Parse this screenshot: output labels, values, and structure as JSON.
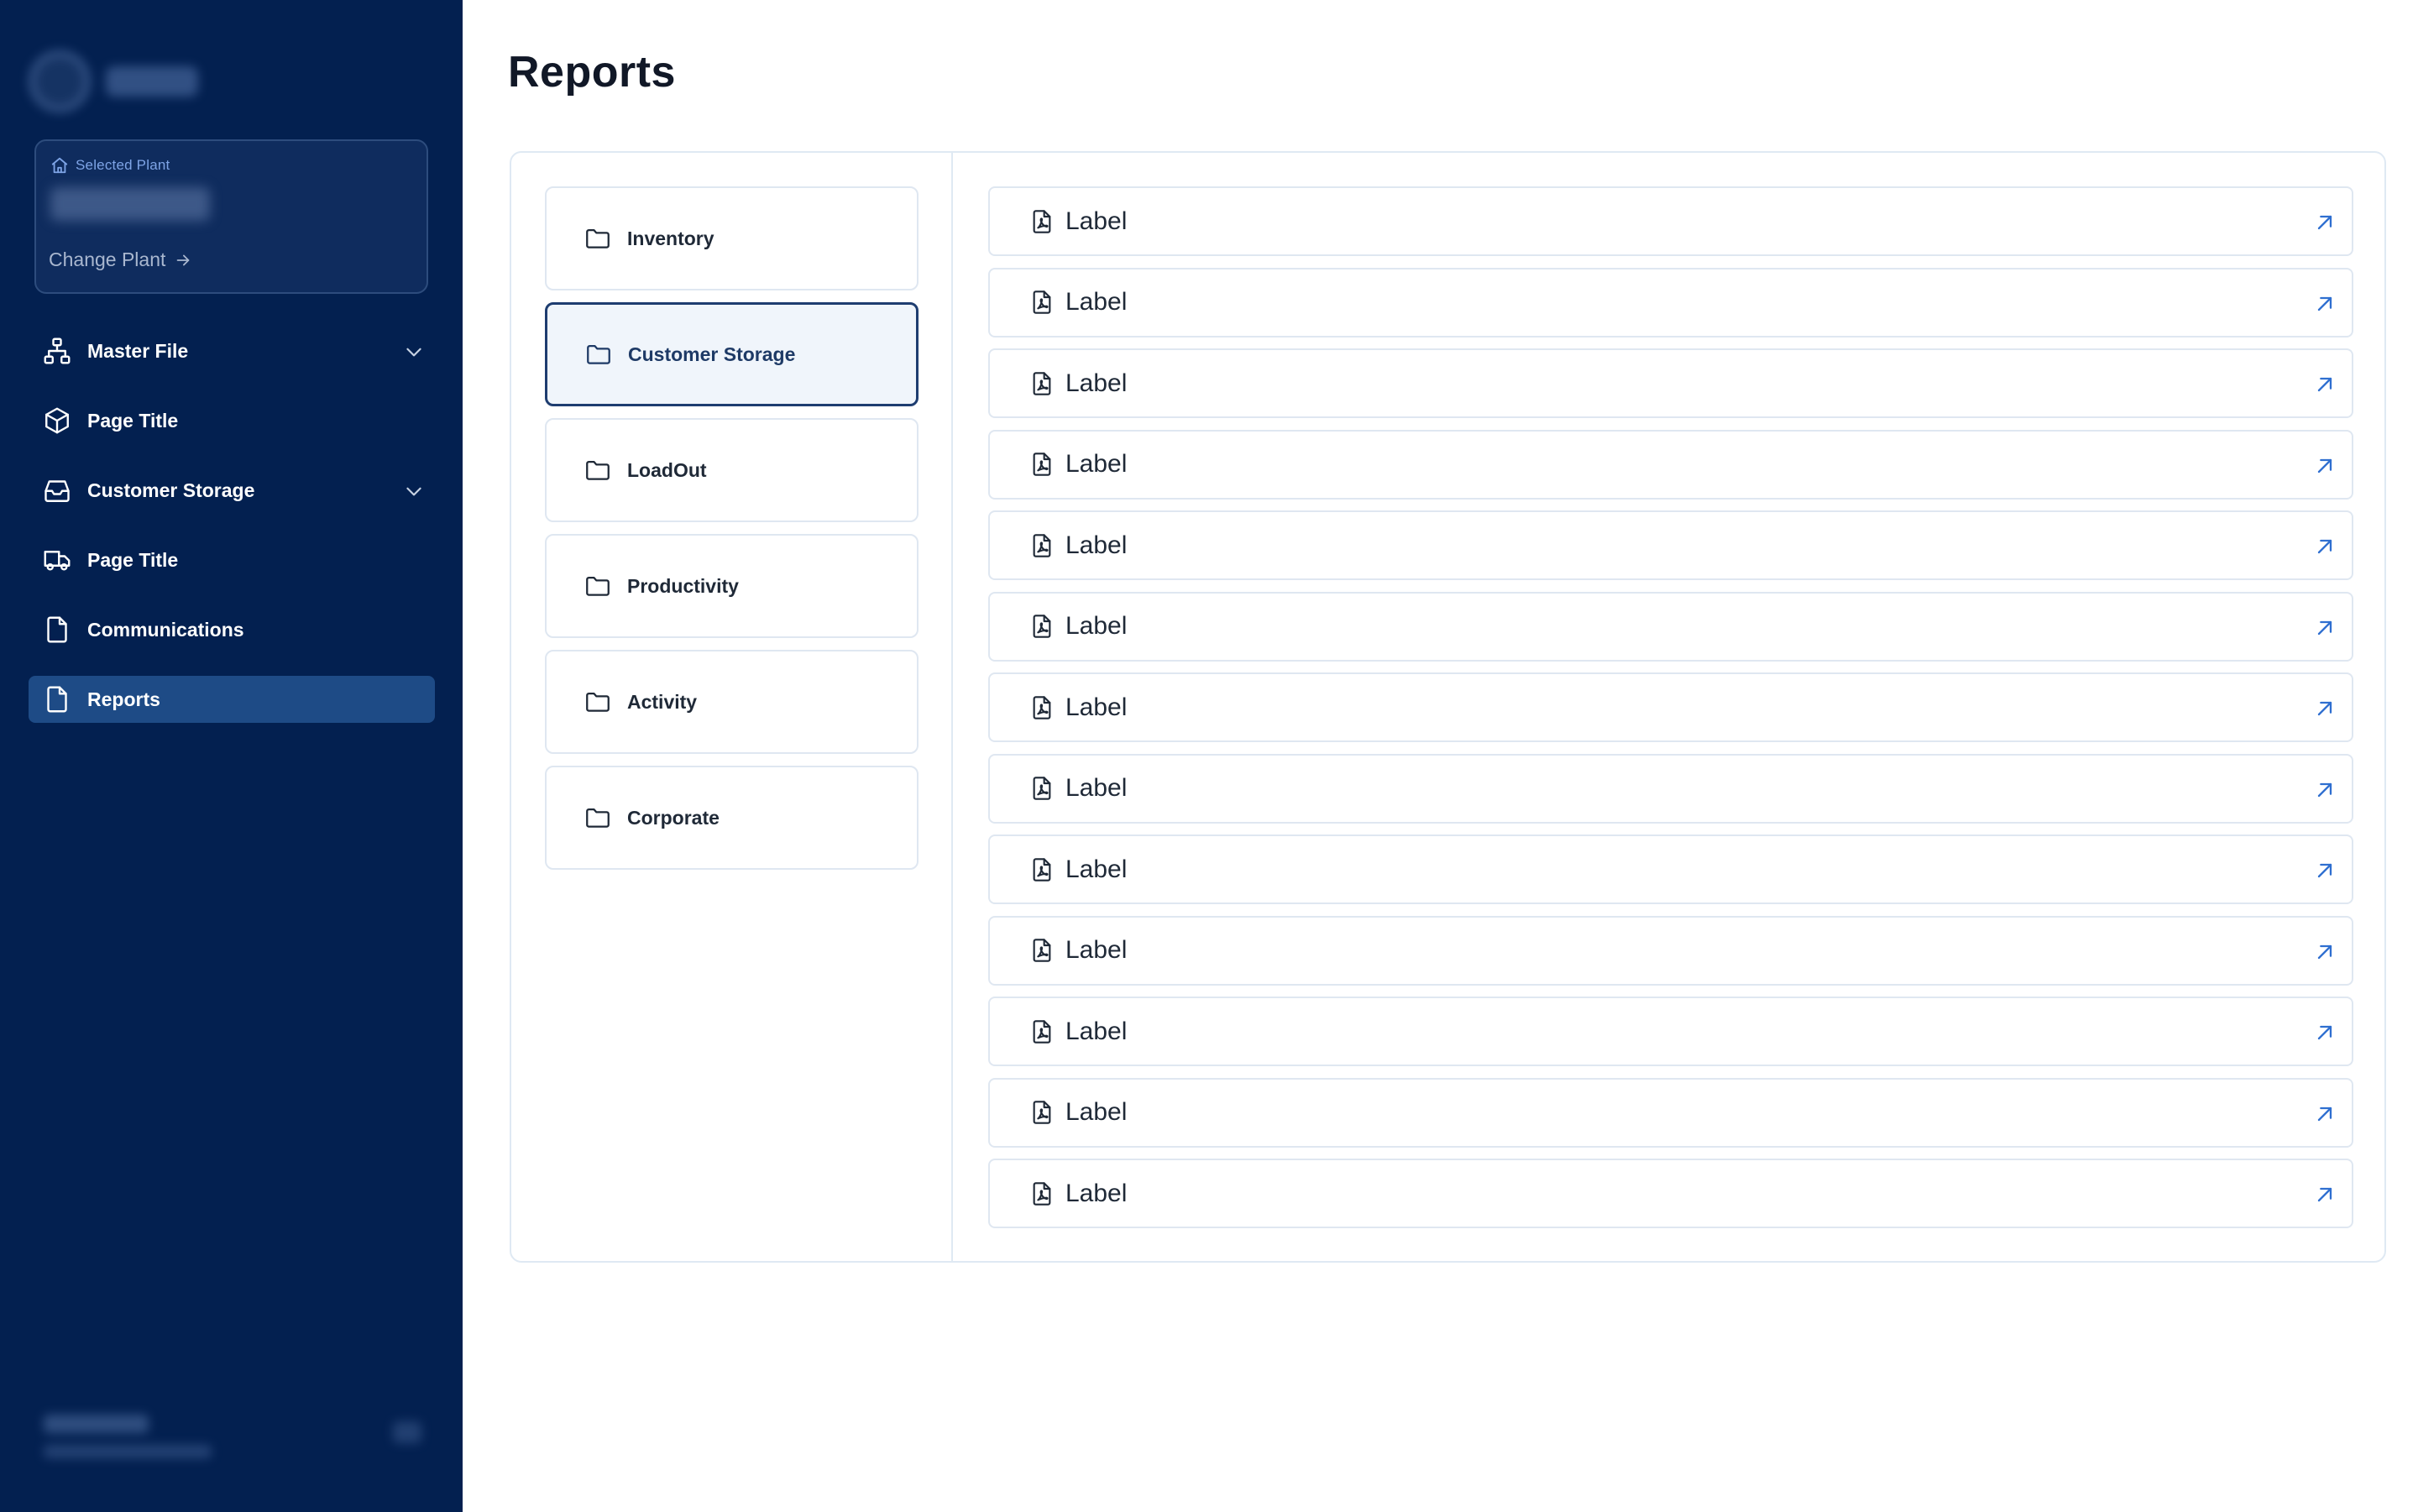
{
  "sidebar": {
    "selected_plant": {
      "label": "Selected Plant",
      "value": "",
      "change_label": "Change Plant"
    },
    "nav": [
      {
        "label": "Master File",
        "icon": "sitemap-icon",
        "expandable": true
      },
      {
        "label": "Page Title",
        "icon": "box-icon",
        "expandable": false
      },
      {
        "label": "Customer Storage",
        "icon": "inbox-icon",
        "expandable": true
      },
      {
        "label": "Page Title",
        "icon": "truck-icon",
        "expandable": false
      },
      {
        "label": "Communications",
        "icon": "file-icon",
        "expandable": false
      },
      {
        "label": "Reports",
        "icon": "file-icon",
        "expandable": false,
        "active": true
      }
    ]
  },
  "main": {
    "title": "Reports",
    "folders": [
      {
        "label": "Inventory"
      },
      {
        "label": "Customer Storage",
        "active": true
      },
      {
        "label": "LoadOut"
      },
      {
        "label": "Productivity"
      },
      {
        "label": "Activity"
      },
      {
        "label": "Corporate"
      }
    ],
    "reports": [
      {
        "label": "Label"
      },
      {
        "label": "Label"
      },
      {
        "label": "Label"
      },
      {
        "label": "Label"
      },
      {
        "label": "Label"
      },
      {
        "label": "Label"
      },
      {
        "label": "Label"
      },
      {
        "label": "Label"
      },
      {
        "label": "Label"
      },
      {
        "label": "Label"
      },
      {
        "label": "Label"
      },
      {
        "label": "Label"
      },
      {
        "label": "Label"
      }
    ]
  },
  "colors": {
    "sidebar_bg": "#032050",
    "active_nav_bg": "#1e4b86",
    "accent_blue": "#2f6fd0",
    "panel_border": "#dfe9f3"
  }
}
